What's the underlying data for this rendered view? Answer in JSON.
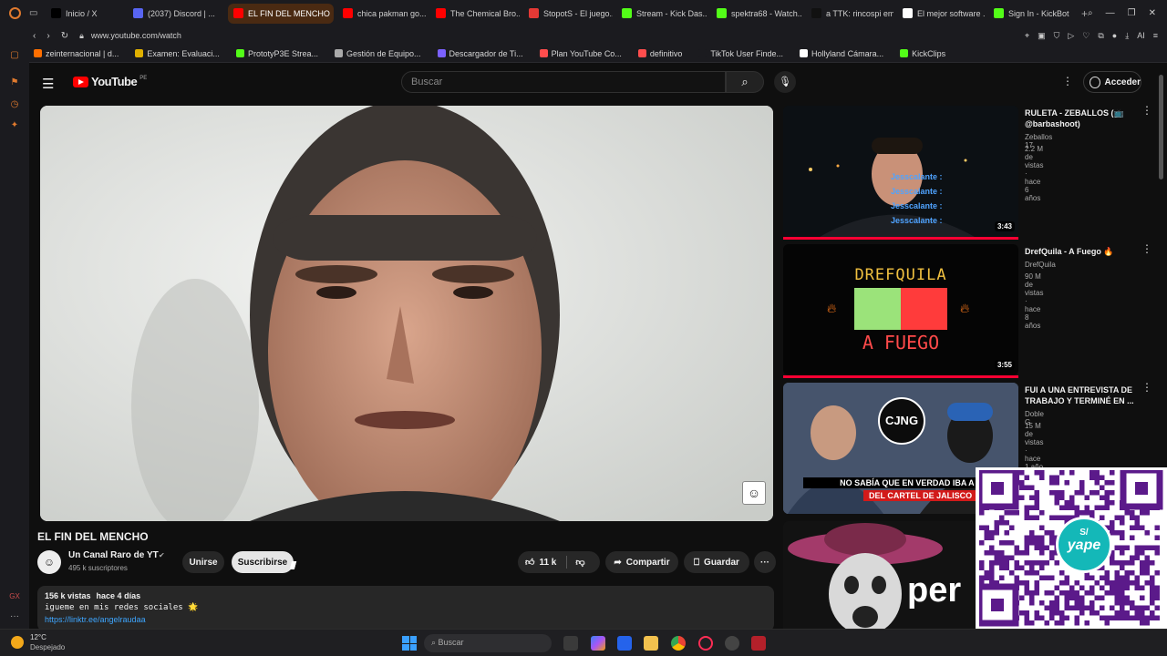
{
  "browser": {
    "tabs": [
      {
        "label": "Inicio / X",
        "color": "#000000",
        "icon": "x-icon"
      },
      {
        "label": "(2037) Discord | ...",
        "color": "#5865f2",
        "icon": "discord-icon"
      },
      {
        "label": "EL FIN DEL MENCHO",
        "color": "#ff0000",
        "icon": "youtube-icon",
        "active": true
      },
      {
        "label": "chica pakman go...",
        "color": "#ff0000",
        "icon": "youtube-icon"
      },
      {
        "label": "The Chemical Bro...",
        "color": "#ff0000",
        "icon": "youtube-icon"
      },
      {
        "label": "StopotS - El juego...",
        "color": "#e53935",
        "icon": "stopots-icon"
      },
      {
        "label": "Stream - Kick Das...",
        "color": "#53fc18",
        "icon": "kick-icon"
      },
      {
        "label": "spektra68 - Watch...",
        "color": "#53fc18",
        "icon": "kick-icon"
      },
      {
        "label": "a TTK: rincospi em...",
        "color": "#111111",
        "icon": "tiktok-icon"
      },
      {
        "label": "El mejor software ...",
        "color": "#ffffff",
        "icon": "software-icon"
      },
      {
        "label": "Sign In - KickBot",
        "color": "#53fc18",
        "icon": "kickbot-icon"
      }
    ],
    "url": "www.youtube.com/watch",
    "ai_label": "AI",
    "bookmarks": [
      {
        "label": "zeinternacional | d...",
        "color": "#ff6f00"
      },
      {
        "label": "Examen: Evaluaci...",
        "color": "#e0b000"
      },
      {
        "label": "PrototyP3E Strea...",
        "color": "#53fc18"
      },
      {
        "label": "Gestión de Equipo...",
        "color": "#aaaaaa"
      },
      {
        "label": "Descargador de Ti...",
        "color": "#7b61ff"
      },
      {
        "label": "Plan YouTube Co...",
        "color": "#ff4d4d"
      },
      {
        "label": "definitivo",
        "color": "#ff4d4d"
      },
      {
        "label": "TikTok User Finde...",
        "color": "#1b1b1f"
      },
      {
        "label": "Hollyland Cámara...",
        "color": "#ffffff"
      },
      {
        "label": "KickClips",
        "color": "#53fc18"
      }
    ]
  },
  "youtube": {
    "logo_text": "YouTube",
    "region": "PE",
    "search_placeholder": "Buscar",
    "signin_label": "Acceder",
    "video": {
      "title": "EL FIN DEL MENCHO",
      "channel": "Un Canal Raro de YT",
      "subscribers": "495 k suscriptores",
      "join_label": "Unirse",
      "subscribe_label": "Suscribirse",
      "likes": "11 k",
      "share_label": "Compartir",
      "save_label": "Guardar",
      "views": "156 k vistas",
      "age": "hace 4 días",
      "desc_line": "igueme en mis redes sociales 🌟",
      "desc_link": "https://linktr.ee/angelraudaa"
    },
    "recommendations": [
      {
        "title": "RULETA - ZEBALLOS (📺 @barbashoot)",
        "channel": "Zeballos 17",
        "views": "2.2 M de vistas",
        "age": "hace 6 años",
        "duration": "3:43",
        "overlay_names": [
          "Jesscalante :",
          "Jesscalante :",
          "Jesscalante :",
          "Jesscalante :"
        ]
      },
      {
        "title": "DrefQuila - A Fuego 🔥",
        "channel": "DrefQuila",
        "views": "90 M de vistas",
        "age": "hace 8 años",
        "duration": "3:55",
        "thumb_top": "DREFQUILA",
        "thumb_bottom": "A FUEGO"
      },
      {
        "title": "FUI A UNA ENTREVISTA DE TRABAJO Y TERMINÉ EN ...",
        "channel": "Doble G",
        "views": "15 M de vistas",
        "age": "hace 1 año",
        "duration": "",
        "thumb_badge": "CJNG",
        "thumb_caption_1": "NO SABÍA QUE EN VERDAD IBA A S",
        "thumb_caption_2": "DEL CARTEL DE JALISCO"
      },
      {
        "title": "",
        "channel": "",
        "views": "",
        "age": "",
        "duration": "",
        "thumb_word": "per"
      }
    ],
    "qr_label": "yape",
    "qr_currency": "S/"
  },
  "taskbar": {
    "temperature": "12°C",
    "weather": "Despejado",
    "search_placeholder": "Buscar"
  }
}
